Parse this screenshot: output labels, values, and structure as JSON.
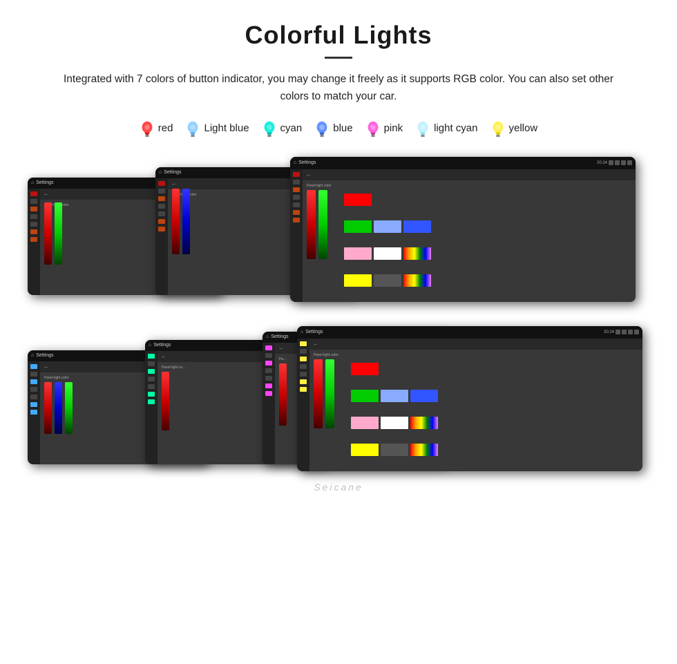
{
  "page": {
    "title": "Colorful Lights",
    "description": "Integrated with 7 colors of button indicator, you may change it freely as it supports RGB color. You can also set other colors to match your car.",
    "colors": [
      {
        "name": "red",
        "color": "#ff2222",
        "bulb_color": "#ff4444"
      },
      {
        "name": "Light blue",
        "color": "#66bbff",
        "bulb_color": "#88ccff"
      },
      {
        "name": "cyan",
        "color": "#00ffee",
        "bulb_color": "#44ffee"
      },
      {
        "name": "blue",
        "color": "#4488ff",
        "bulb_color": "#5599ff"
      },
      {
        "name": "pink",
        "color": "#ff44cc",
        "bulb_color": "#ff66dd"
      },
      {
        "name": "light cyan",
        "color": "#aaeeff",
        "bulb_color": "#ccf4ff"
      },
      {
        "name": "yellow",
        "color": "#ffdd22",
        "bulb_color": "#ffee44"
      }
    ],
    "screens": {
      "row1": [
        "screen1",
        "screen2",
        "screen3"
      ],
      "row2": [
        "screen4",
        "screen5",
        "screen6",
        "screen7"
      ]
    },
    "watermark": "Seicane"
  }
}
